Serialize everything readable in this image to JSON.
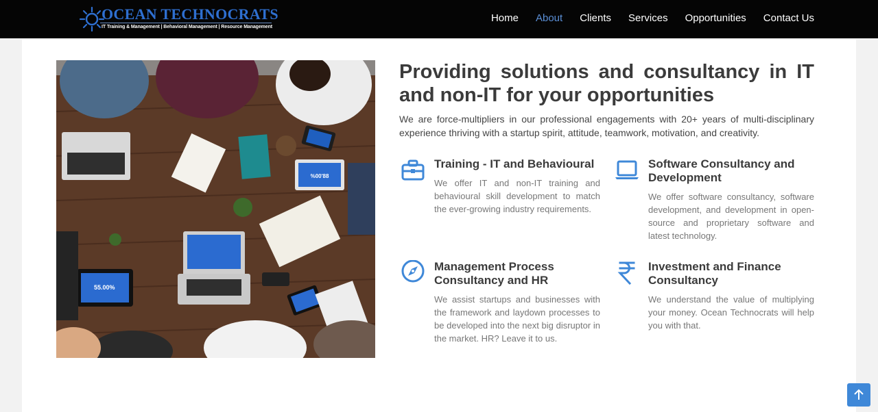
{
  "header": {
    "logo": {
      "title": "OCEAN TECHNOCRATS",
      "tagline": "IT Training & Management | Behavioral Management | Resource Management"
    },
    "nav": [
      {
        "label": "Home",
        "active": false
      },
      {
        "label": "About",
        "active": true
      },
      {
        "label": "Clients",
        "active": false
      },
      {
        "label": "Services",
        "active": false
      },
      {
        "label": "Opportunities",
        "active": false
      },
      {
        "label": "Contact Us",
        "active": false
      }
    ]
  },
  "about": {
    "headline": "Providing solutions and consultancy in IT and non-IT for your opportunities",
    "intro": "We are force-multipliers in our professional engagements with 20+ years of multi-disciplinary experience thriving with a startup spirit, attitude, teamwork, motivation, and creativity.",
    "photo_screen_texts": [
      "%00'88",
      "55.00%"
    ],
    "services": [
      {
        "icon": "briefcase-icon",
        "title": "Training - IT and Behavioural",
        "text": "We offer IT and non-IT training and behavioural skill development to match the ever-growing industry requirements."
      },
      {
        "icon": "laptop-icon",
        "title": "Software Consultancy and Development",
        "text": "We offer software consultancy, software development, and development in open-source and proprietary software and latest technology."
      },
      {
        "icon": "compass-icon",
        "title": "Management Process Consultancy and HR",
        "text": "We assist startups and businesses with the framework and laydown processes to be developed into the next big disruptor in the market. HR? Leave it to us."
      },
      {
        "icon": "rupee-icon",
        "title": "Investment and Finance Consultancy",
        "text": "We understand the value of multiplying your money. Ocean Technocrats will help you with that."
      }
    ]
  },
  "colors": {
    "accent": "#3f88d8",
    "nav_active": "#5b8fd6",
    "header_bg": "#050505"
  }
}
